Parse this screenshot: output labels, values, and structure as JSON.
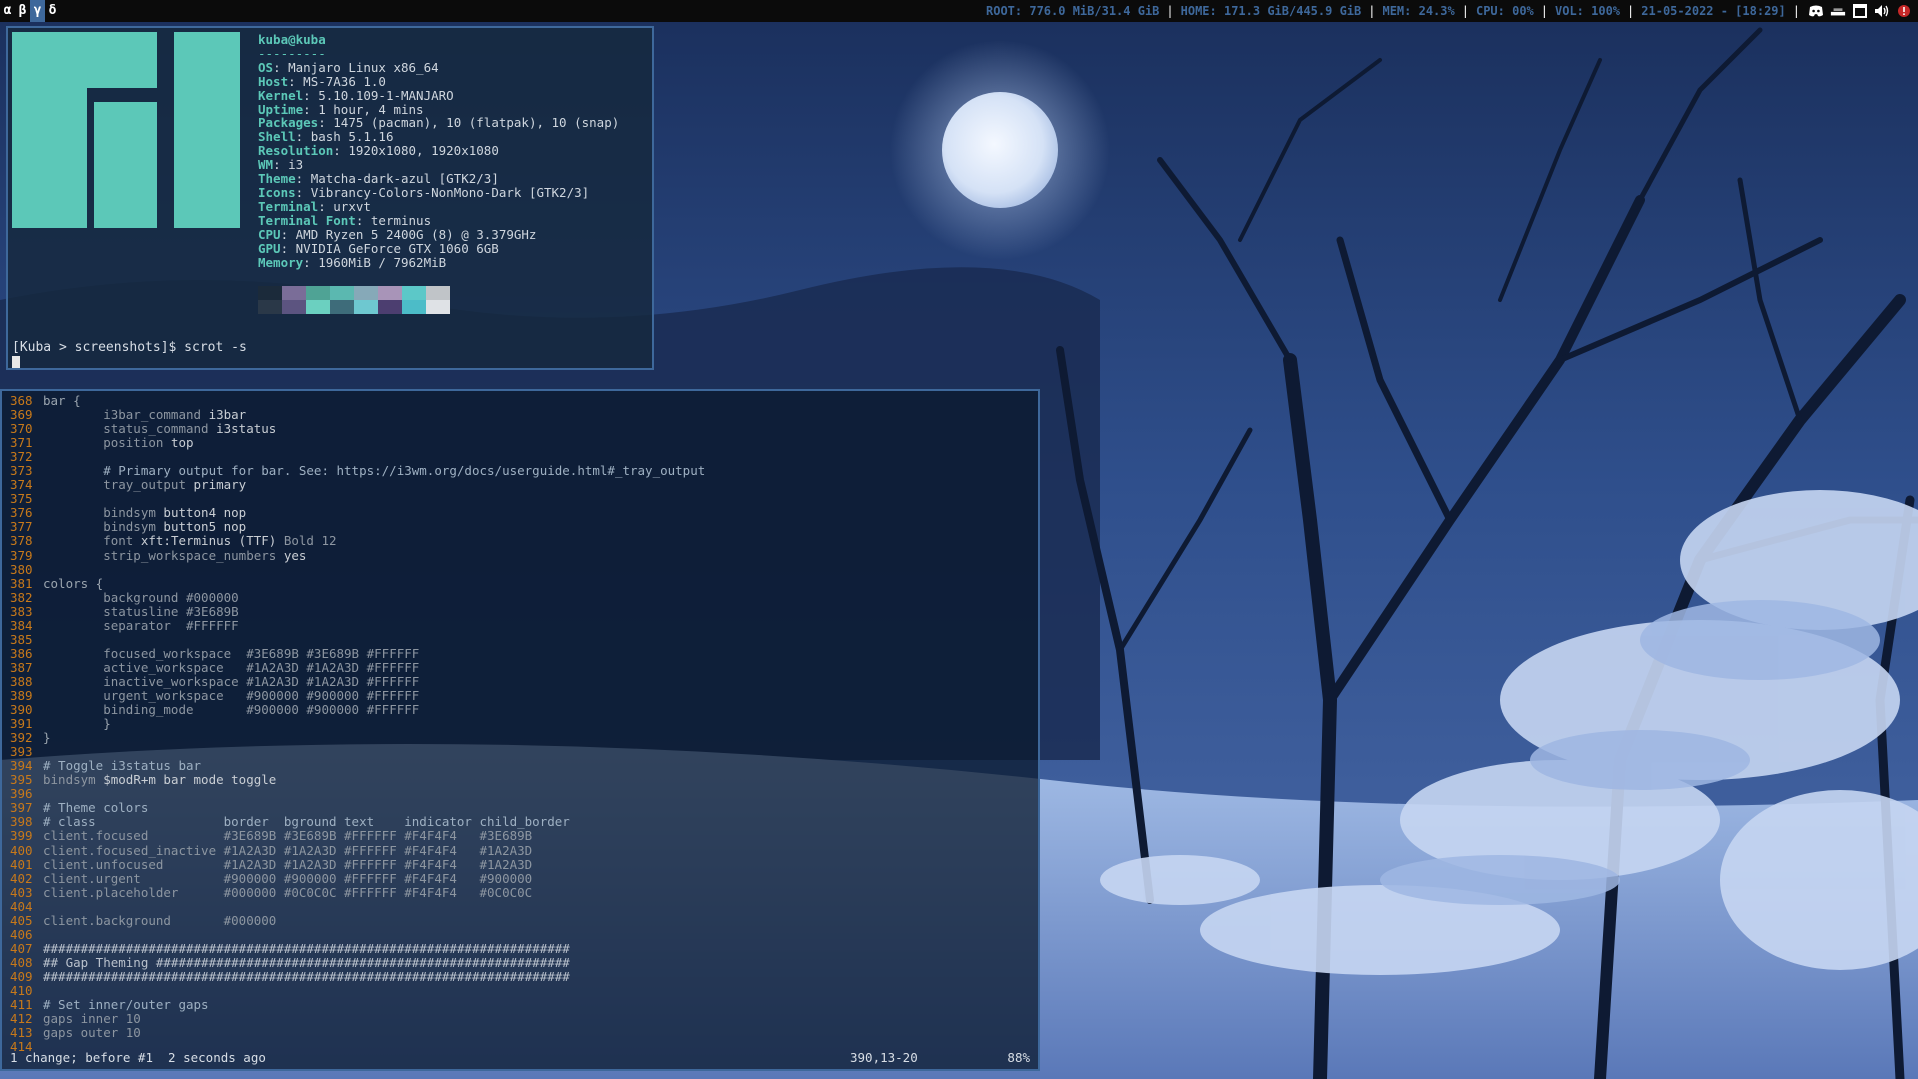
{
  "colors": {
    "bar_bg": "#0b0b0b",
    "accent": "#3E689B",
    "status_text": "#3E689B",
    "separator": "#FFFFFF",
    "terminal_border": "#3E689B",
    "line_number": "#c8791a",
    "neofetch_key": "#5cc8b8"
  },
  "topbar": {
    "workspaces": [
      "α",
      "β",
      "γ",
      "δ"
    ],
    "focused_workspace": "γ",
    "status": {
      "root": "ROOT: 776.0 MiB/31.4 GiB",
      "home": "HOME: 171.3 GiB/445.9 GiB",
      "mem": "MEM: 24.3%",
      "cpu": "CPU: 00%",
      "vol": "VOL: 100%",
      "datetime": "21-05-2022 - [18:29]"
    },
    "separator": "|",
    "tray_icons": [
      "discord-icon",
      "network-icon",
      "window-icon",
      "volume-icon",
      "notification-icon"
    ]
  },
  "neofetch": {
    "user_host": "kuba@kuba",
    "dashes": "---------",
    "fields": [
      {
        "key": "OS",
        "value": "Manjaro Linux x86_64"
      },
      {
        "key": "Host",
        "value": "MS-7A36 1.0"
      },
      {
        "key": "Kernel",
        "value": "5.10.109-1-MANJARO"
      },
      {
        "key": "Uptime",
        "value": "1 hour, 4 mins"
      },
      {
        "key": "Packages",
        "value": "1475 (pacman), 10 (flatpak), 10 (snap)"
      },
      {
        "key": "Shell",
        "value": "bash 5.1.16"
      },
      {
        "key": "Resolution",
        "value": "1920x1080, 1920x1080"
      },
      {
        "key": "WM",
        "value": "i3"
      },
      {
        "key": "Theme",
        "value": "Matcha-dark-azul [GTK2/3]"
      },
      {
        "key": "Icons",
        "value": "Vibrancy-Colors-NonMono-Dark [GTK2/3]"
      },
      {
        "key": "Terminal",
        "value": "urxvt"
      },
      {
        "key": "Terminal Font",
        "value": "terminus"
      },
      {
        "key": "CPU",
        "value": "AMD Ryzen 5 2400G (8) @ 3.379GHz"
      },
      {
        "key": "GPU",
        "value": "NVIDIA GeForce GTX 1060 6GB"
      },
      {
        "key": "Memory",
        "value": "1960MiB / 7962MiB"
      }
    ],
    "palette_top": [
      "#1b2a3a",
      "#7a6d98",
      "#4fa395",
      "#5bb8b0",
      "#86a9b8",
      "#a894b8",
      "#5cc8c8",
      "#c0c4c8"
    ],
    "palette_bottom": [
      "#2a3848",
      "#5c5480",
      "#6bd0c0",
      "#3e6c7a",
      "#6ec8d0",
      "#4c3e70",
      "#4cbcc8",
      "#dfe2e6"
    ],
    "prompt": "[Kuba > screenshots]$ scrot -s"
  },
  "vim": {
    "lines": [
      {
        "n": "368",
        "segs": [
          [
            "c-kw",
            "bar {"
          ]
        ]
      },
      {
        "n": "369",
        "segs": [
          [
            "c-prop",
            "        i3bar_command "
          ],
          [
            "c-val",
            "i3bar"
          ]
        ]
      },
      {
        "n": "370",
        "segs": [
          [
            "c-prop",
            "        status_command "
          ],
          [
            "c-val",
            "i3status"
          ]
        ]
      },
      {
        "n": "371",
        "segs": [
          [
            "c-prop",
            "        position "
          ],
          [
            "c-val",
            "top"
          ]
        ]
      },
      {
        "n": "372",
        "segs": []
      },
      {
        "n": "373",
        "segs": [
          [
            "c-com",
            "        # Primary output for bar. See: https://i3wm.org/docs/userguide.html#_tray_output"
          ]
        ]
      },
      {
        "n": "374",
        "segs": [
          [
            "c-prop",
            "        tray_output "
          ],
          [
            "c-val",
            "primary"
          ]
        ]
      },
      {
        "n": "375",
        "segs": []
      },
      {
        "n": "376",
        "segs": [
          [
            "c-prop",
            "        bindsym "
          ],
          [
            "c-val",
            "button4 nop"
          ]
        ]
      },
      {
        "n": "377",
        "segs": [
          [
            "c-prop",
            "        bindsym "
          ],
          [
            "c-val",
            "button5 nop"
          ]
        ]
      },
      {
        "n": "378",
        "segs": [
          [
            "c-prop",
            "        font "
          ],
          [
            "c-val",
            "xft:Terminus (TTF) "
          ],
          [
            "c-prop",
            "Bold 12"
          ]
        ]
      },
      {
        "n": "379",
        "segs": [
          [
            "c-prop",
            "        strip_workspace_numbers "
          ],
          [
            "c-val",
            "yes"
          ]
        ]
      },
      {
        "n": "380",
        "segs": []
      },
      {
        "n": "381",
        "segs": [
          [
            "c-kw",
            "colors {"
          ]
        ]
      },
      {
        "n": "382",
        "segs": [
          [
            "c-prop",
            "        background "
          ],
          [
            "c-hex",
            "#000000"
          ]
        ]
      },
      {
        "n": "383",
        "segs": [
          [
            "c-prop",
            "        statusline "
          ],
          [
            "c-hex",
            "#3E689B"
          ]
        ]
      },
      {
        "n": "384",
        "segs": [
          [
            "c-prop",
            "        separator  "
          ],
          [
            "c-hex",
            "#FFFFFF"
          ]
        ]
      },
      {
        "n": "385",
        "segs": []
      },
      {
        "n": "386",
        "segs": [
          [
            "c-prop",
            "        focused_workspace  "
          ],
          [
            "c-hex",
            "#3E689B #3E689B #FFFFFF"
          ]
        ]
      },
      {
        "n": "387",
        "segs": [
          [
            "c-prop",
            "        active_workspace   "
          ],
          [
            "c-hex",
            "#1A2A3D #1A2A3D #FFFFFF"
          ]
        ]
      },
      {
        "n": "388",
        "segs": [
          [
            "c-prop",
            "        inactive_workspace "
          ],
          [
            "c-hex",
            "#1A2A3D #1A2A3D #FFFFFF"
          ]
        ]
      },
      {
        "n": "389",
        "segs": [
          [
            "c-prop",
            "        urgent_workspace   "
          ],
          [
            "c-hex",
            "#900000 #900000 #FFFFFF"
          ]
        ]
      },
      {
        "n": "390",
        "segs": [
          [
            "c-prop",
            "        binding_mode       "
          ],
          [
            "c-hex",
            "#900000 #900000 #FFFFFF"
          ]
        ]
      },
      {
        "n": "391",
        "segs": [
          [
            "c-kw",
            "        }"
          ]
        ]
      },
      {
        "n": "392",
        "segs": [
          [
            "c-kw",
            "}"
          ]
        ]
      },
      {
        "n": "393",
        "segs": []
      },
      {
        "n": "394",
        "segs": [
          [
            "c-com",
            "# Toggle i3status bar"
          ]
        ]
      },
      {
        "n": "395",
        "segs": [
          [
            "c-prop",
            "bindsym "
          ],
          [
            "c-val",
            "$modR+m bar mode toggle"
          ]
        ]
      },
      {
        "n": "396",
        "segs": []
      },
      {
        "n": "397",
        "segs": [
          [
            "c-com",
            "# Theme colors"
          ]
        ]
      },
      {
        "n": "398",
        "segs": [
          [
            "c-com",
            "# class                 border  bground text    indicator child_border"
          ]
        ]
      },
      {
        "n": "399",
        "segs": [
          [
            "c-prop",
            "client.focused          "
          ],
          [
            "c-hex",
            "#3E689B #3E689B #FFFFFF #F4F4F4   #3E689B"
          ]
        ]
      },
      {
        "n": "400",
        "segs": [
          [
            "c-prop",
            "client.focused_inactive "
          ],
          [
            "c-hex",
            "#1A2A3D #1A2A3D #FFFFFF #F4F4F4   #1A2A3D"
          ]
        ]
      },
      {
        "n": "401",
        "segs": [
          [
            "c-prop",
            "client.unfocused        "
          ],
          [
            "c-hex",
            "#1A2A3D #1A2A3D #FFFFFF #F4F4F4   #1A2A3D"
          ]
        ]
      },
      {
        "n": "402",
        "segs": [
          [
            "c-prop",
            "client.urgent           "
          ],
          [
            "c-hex",
            "#900000 #900000 #FFFFFF #F4F4F4   #900000"
          ]
        ]
      },
      {
        "n": "403",
        "segs": [
          [
            "c-prop",
            "client.placeholder      "
          ],
          [
            "c-hex",
            "#000000 #0C0C0C #FFFFFF #F4F4F4   #0C0C0C"
          ]
        ]
      },
      {
        "n": "404",
        "segs": []
      },
      {
        "n": "405",
        "segs": [
          [
            "c-prop",
            "client.background       "
          ],
          [
            "c-hex",
            "#000000"
          ]
        ]
      },
      {
        "n": "406",
        "segs": []
      },
      {
        "n": "407",
        "segs": [
          [
            "c-hash",
            "######################################################################"
          ]
        ]
      },
      {
        "n": "408",
        "segs": [
          [
            "c-hash",
            "## Gap Theming #######################################################"
          ]
        ]
      },
      {
        "n": "409",
        "segs": [
          [
            "c-hash",
            "######################################################################"
          ]
        ]
      },
      {
        "n": "410",
        "segs": []
      },
      {
        "n": "411",
        "segs": [
          [
            "c-com",
            "# Set inner/outer gaps"
          ]
        ]
      },
      {
        "n": "412",
        "segs": [
          [
            "c-prop",
            "gaps inner 10"
          ]
        ]
      },
      {
        "n": "413",
        "segs": [
          [
            "c-prop",
            "gaps outer 10"
          ]
        ]
      },
      {
        "n": "414",
        "segs": []
      }
    ],
    "status_message": "1 change; before #1  2 seconds ago",
    "cursor_position": "390,13-20",
    "percent": "88%"
  }
}
